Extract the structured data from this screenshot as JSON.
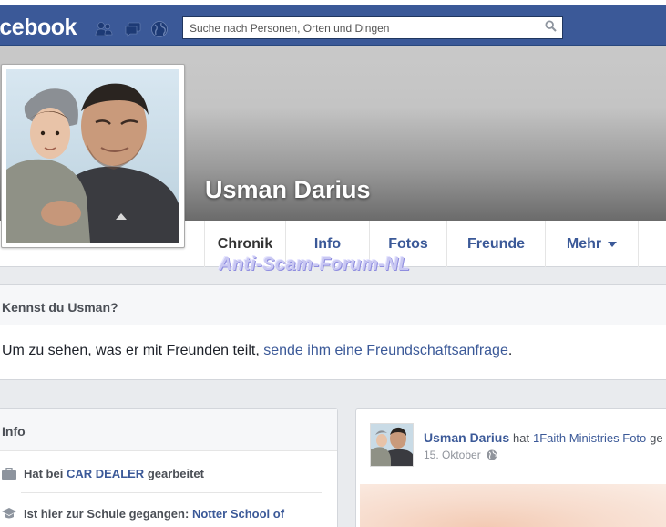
{
  "topbar": {
    "logo_text": "acebook",
    "search_placeholder": "Suche nach Personen, Orten und Dingen",
    "icons": [
      "friends-icon",
      "messages-icon",
      "globe-icon",
      "search-icon"
    ],
    "brand_color": "#3b5998"
  },
  "profile": {
    "name": "Usman Darius"
  },
  "nav": {
    "tabs": [
      {
        "label": "Chronik"
      },
      {
        "label": "Info"
      },
      {
        "label": "Fotos"
      },
      {
        "label": "Freunde"
      },
      {
        "label": "Mehr"
      }
    ]
  },
  "watermark": "Anti-Scam-Forum-NL",
  "know": {
    "title": "Kennst du Usman?",
    "text": "Um zu sehen, was er mit Freunden teilt,",
    "link": "sende ihm eine Freundschaftsanfrage",
    "end": "."
  },
  "info": {
    "title": "Info",
    "work_prefix": "Hat bei",
    "work_place": "CAR DEALER",
    "work_suffix": "gearbeitet",
    "school_prefix": "Ist hier zur Schule gegangen:",
    "school_place": "Notter School of"
  },
  "post": {
    "author": "Usman Darius",
    "verb": "hat",
    "target": "1Faith Ministries Foto",
    "suffix": "ge",
    "date": "15. Oktober"
  }
}
